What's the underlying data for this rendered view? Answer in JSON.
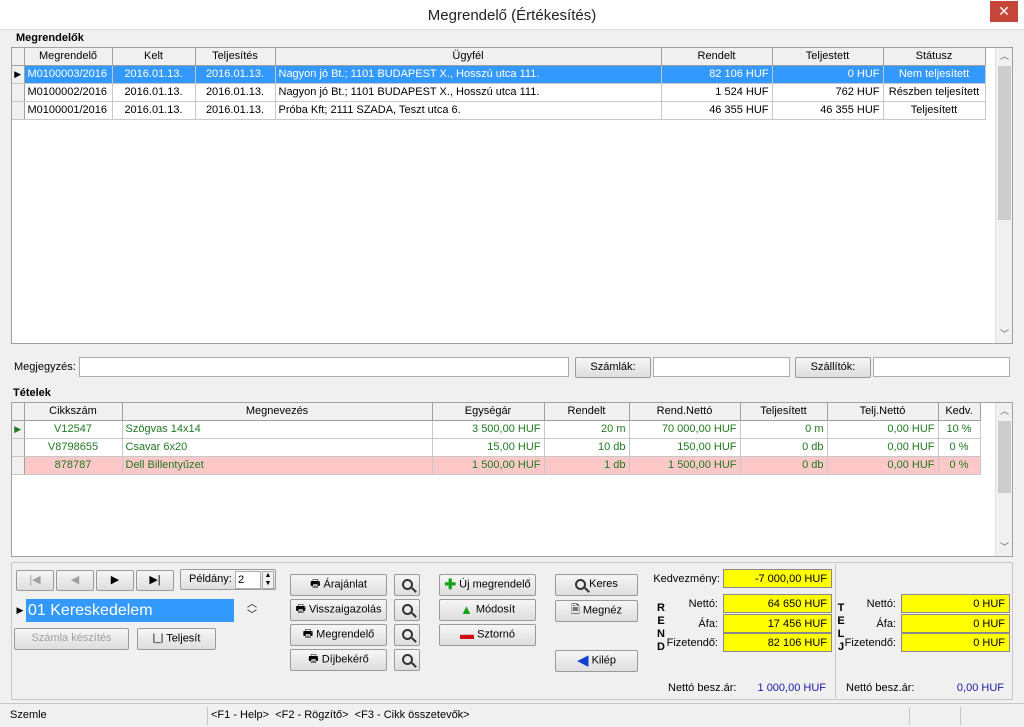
{
  "window": {
    "title": "Megrendelő (Értékesítés)",
    "close_glyph": "✕"
  },
  "orders": {
    "group_title": "Megrendelők",
    "columns": [
      "Megrendelő",
      "Kelt",
      "Teljesítés",
      "Ügyfél",
      "Rendelt",
      "Teljestett",
      "Státusz"
    ],
    "rows": [
      [
        "M0100003/2016",
        "2016.01.13.",
        "2016.01.13.",
        "Nagyon jó Bt.;  1101 BUDAPEST X., Hosszú utca 111.",
        "82 106 HUF",
        "0 HUF",
        "Nem teljesített"
      ],
      [
        "M0100002/2016",
        "2016.01.13.",
        "2016.01.13.",
        "Nagyon jó Bt.;  1101 BUDAPEST X., Hosszú utca 111.",
        "1 524 HUF",
        "762 HUF",
        "Részben teljesített"
      ],
      [
        "M0100001/2016",
        "2016.01.13.",
        "2016.01.13.",
        "Próba Kft;  2111 SZADA, Teszt utca 6.",
        "46 355 HUF",
        "46 355 HUF",
        "Teljesített"
      ]
    ]
  },
  "notes": {
    "label": "Megjegyzés:",
    "value": "",
    "invoices_label": "Számlák:",
    "suppliers_label": "Szállítók:"
  },
  "items": {
    "group_title": "Tételek",
    "columns": [
      "Cikkszám",
      "Megnevezés",
      "Egységár",
      "Rendelt",
      "Rend.Nettó",
      "Teljesített",
      "Telj.Nettó",
      "Kedv."
    ],
    "rows": [
      [
        "V12547",
        "Szögvas 14x14",
        "3 500,00 HUF",
        "20  m",
        "70 000,00 HUF",
        "0  m",
        "0,00 HUF",
        "10 %"
      ],
      [
        "V8798655",
        "Csavar 6x20",
        "15,00 HUF",
        "10  db",
        "150,00 HUF",
        "0  db",
        "0,00 HUF",
        "0 %"
      ],
      [
        "878787",
        "Dell Billentyűzet",
        "1 500,00 HUF",
        "1  db",
        "1 500,00 HUF",
        "0  db",
        "0,00 HUF",
        "0 %"
      ]
    ]
  },
  "nav": {
    "first": "|◀",
    "prev": "◀",
    "next": "▶",
    "last": "▶|",
    "copies_label": "Példány:",
    "copies_value": "2"
  },
  "company": {
    "value": "01 Kereskedelem"
  },
  "buttons": {
    "invoice": "Számla készítés",
    "fulfill": "Teljesít",
    "quote": "Árajánlat",
    "confirm": "Visszaigazolás",
    "order": "Megrendelő",
    "fee": "Díjbekérő",
    "new": "Új megrendelő",
    "modify": "Módosít",
    "cancel": "Sztornó",
    "search": "Keres",
    "view": "Megnéz",
    "exit": "Kilép"
  },
  "totals": {
    "discount_label": "Kedvezmény:",
    "discount": "-7 000,00 HUF",
    "rend_letters": [
      "R",
      "E",
      "N",
      "D"
    ],
    "telj_letters": [
      "T",
      "E",
      "L",
      "J"
    ],
    "net_label": "Nettó:",
    "vat_label": "Áfa:",
    "pay_label": "Fizetendő:",
    "rend_net": "64 650 HUF",
    "rend_vat": "17 456 HUF",
    "rend_pay": "82 106 HUF",
    "telj_net": "0 HUF",
    "telj_vat": "0 HUF",
    "telj_pay": "0 HUF",
    "purchase_label": "Nettó besz.ár:",
    "rend_purchase": "1 000,00 HUF",
    "telj_purchase": "0,00 HUF"
  },
  "status": {
    "mode": "Szemle",
    "keys": "<F1 - Help>  <F2 - Rögzítő>  <F3 - Cikk összetevők>"
  },
  "colors": {
    "selection": "#3399ff",
    "highlight_row": "#ffc8c8",
    "yellow_box": "#ffff00",
    "green_text": "#1f7a1f",
    "close": "#c7463a"
  }
}
